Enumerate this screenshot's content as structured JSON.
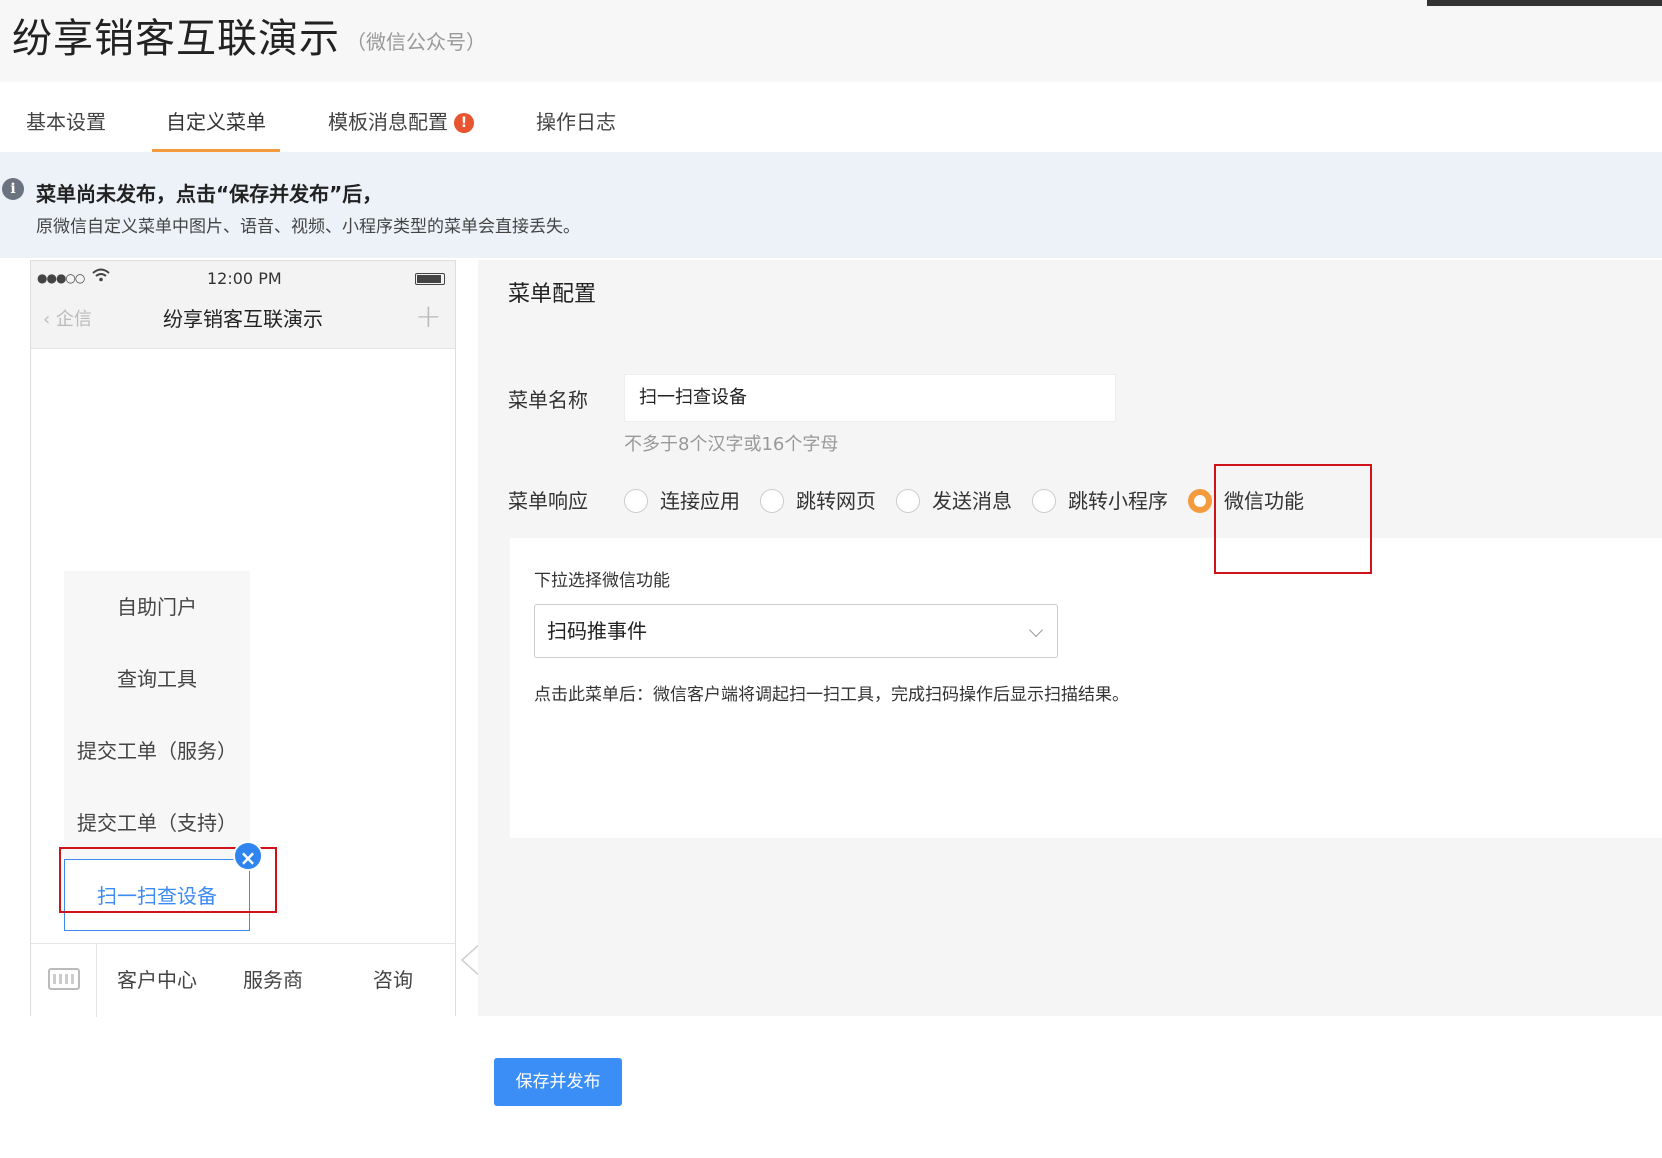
{
  "header": {
    "title": "纷享销客互联演示",
    "subtitle": "（微信公众号）"
  },
  "tabs": [
    {
      "label": "基本设置",
      "active": false
    },
    {
      "label": "自定义菜单",
      "active": true
    },
    {
      "label": "模板消息配置",
      "active": false,
      "badge": "!"
    },
    {
      "label": "操作日志",
      "active": false
    }
  ],
  "notice": {
    "icon": "info-icon",
    "line1": "菜单尚未发布，点击“保存并发布”后，",
    "line2": "原微信自定义菜单中图片、语音、视频、小程序类型的菜单会直接丢失。"
  },
  "phone": {
    "status": {
      "signal": "●●●○○",
      "time": "12:00 PM"
    },
    "back_label": "企信",
    "account_name": "纷享销客互联演示",
    "submenu": [
      {
        "label": "自助门户"
      },
      {
        "label": "查询工具"
      },
      {
        "label": "提交工单（服务）"
      },
      {
        "label": "提交工单（支持）"
      },
      {
        "label": "扫一扫查设备",
        "active": true
      }
    ],
    "main_menu": [
      {
        "label": "客户中心"
      },
      {
        "label": "服务商"
      },
      {
        "label": "咨询"
      }
    ]
  },
  "config": {
    "title": "菜单配置",
    "name_label": "菜单名称",
    "name_value": "扫一扫查设备",
    "name_hint": "不多于8个汉字或16个字母",
    "response_label": "菜单响应",
    "response_options": [
      {
        "label": "连接应用",
        "checked": false
      },
      {
        "label": "跳转网页",
        "checked": false
      },
      {
        "label": "发送消息",
        "checked": false
      },
      {
        "label": "跳转小程序",
        "checked": false
      },
      {
        "label": "微信功能",
        "checked": true
      }
    ],
    "function_label": "下拉选择微信功能",
    "function_value": "扫码推事件",
    "function_desc": "点击此菜单后：微信客户端将调起扫一扫工具，完成扫码操作后显示扫描结果。"
  },
  "actions": {
    "save_label": "保存并发布"
  },
  "colors": {
    "accent": "#f39b3d",
    "primary": "#3a8ef6",
    "highlight_box": "#d0121b",
    "badge": "#e8542f"
  }
}
